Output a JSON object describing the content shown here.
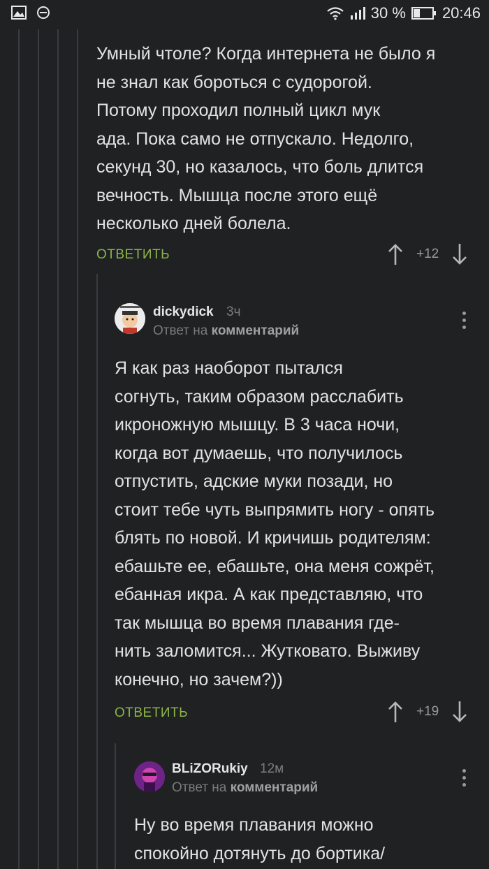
{
  "status_bar": {
    "signal_percent": "30 %",
    "time": "20:46",
    "icons": [
      "image-icon",
      "no-sign-icon",
      "wifi-icon",
      "signal-icon",
      "battery-icon"
    ]
  },
  "comments": [
    {
      "text_lines": [
        "Умный чтоле? Когда интернета не было я",
        "не знал как бороться с судорогой.",
        "Потому проходил полный цикл мук",
        "ада. Пока само не отпускало. Недолго,",
        "секунд 30, но казалось, что боль длится",
        "вечность. Мышца после этого ещё",
        "несколько дней болела."
      ],
      "reply_label": "ОТВЕТИТЬ",
      "score": "+12"
    },
    {
      "username": "dickydick",
      "time": "3ч",
      "reply_prefix": "Ответ на",
      "reply_target": "комментарий",
      "text_lines": [
        "Я как раз наоборот пытался",
        "согнуть, таким образом расслабить",
        "икроножную мышцу. В 3 часа ночи,",
        "когда вот думаешь, что получилось",
        "отпустить, адские муки позади, но",
        "стоит тебе чуть выпрямить ногу - опять",
        "блять по новой. И кричишь родителям:",
        "ебашьте ее, ебашьте, она меня сожрёт,",
        "ебанная икра. А как представляю, что",
        "так мышца во время плавания где-",
        "нить заломится... Жутковато. Выживу",
        "конечно, но зачем?))"
      ],
      "reply_label": "ОТВЕТИТЬ",
      "score": "+19"
    },
    {
      "username": "BLiZORukiy",
      "time": "12м",
      "reply_prefix": "Ответ на",
      "reply_target": "комментарий",
      "text_lines": [
        "Ну во время плавания можно",
        "спокойно дотянуть до бортика/"
      ]
    }
  ],
  "colors": {
    "background": "#1f2123",
    "reply_green": "#8db449",
    "thread_line": "#3a3d40"
  }
}
